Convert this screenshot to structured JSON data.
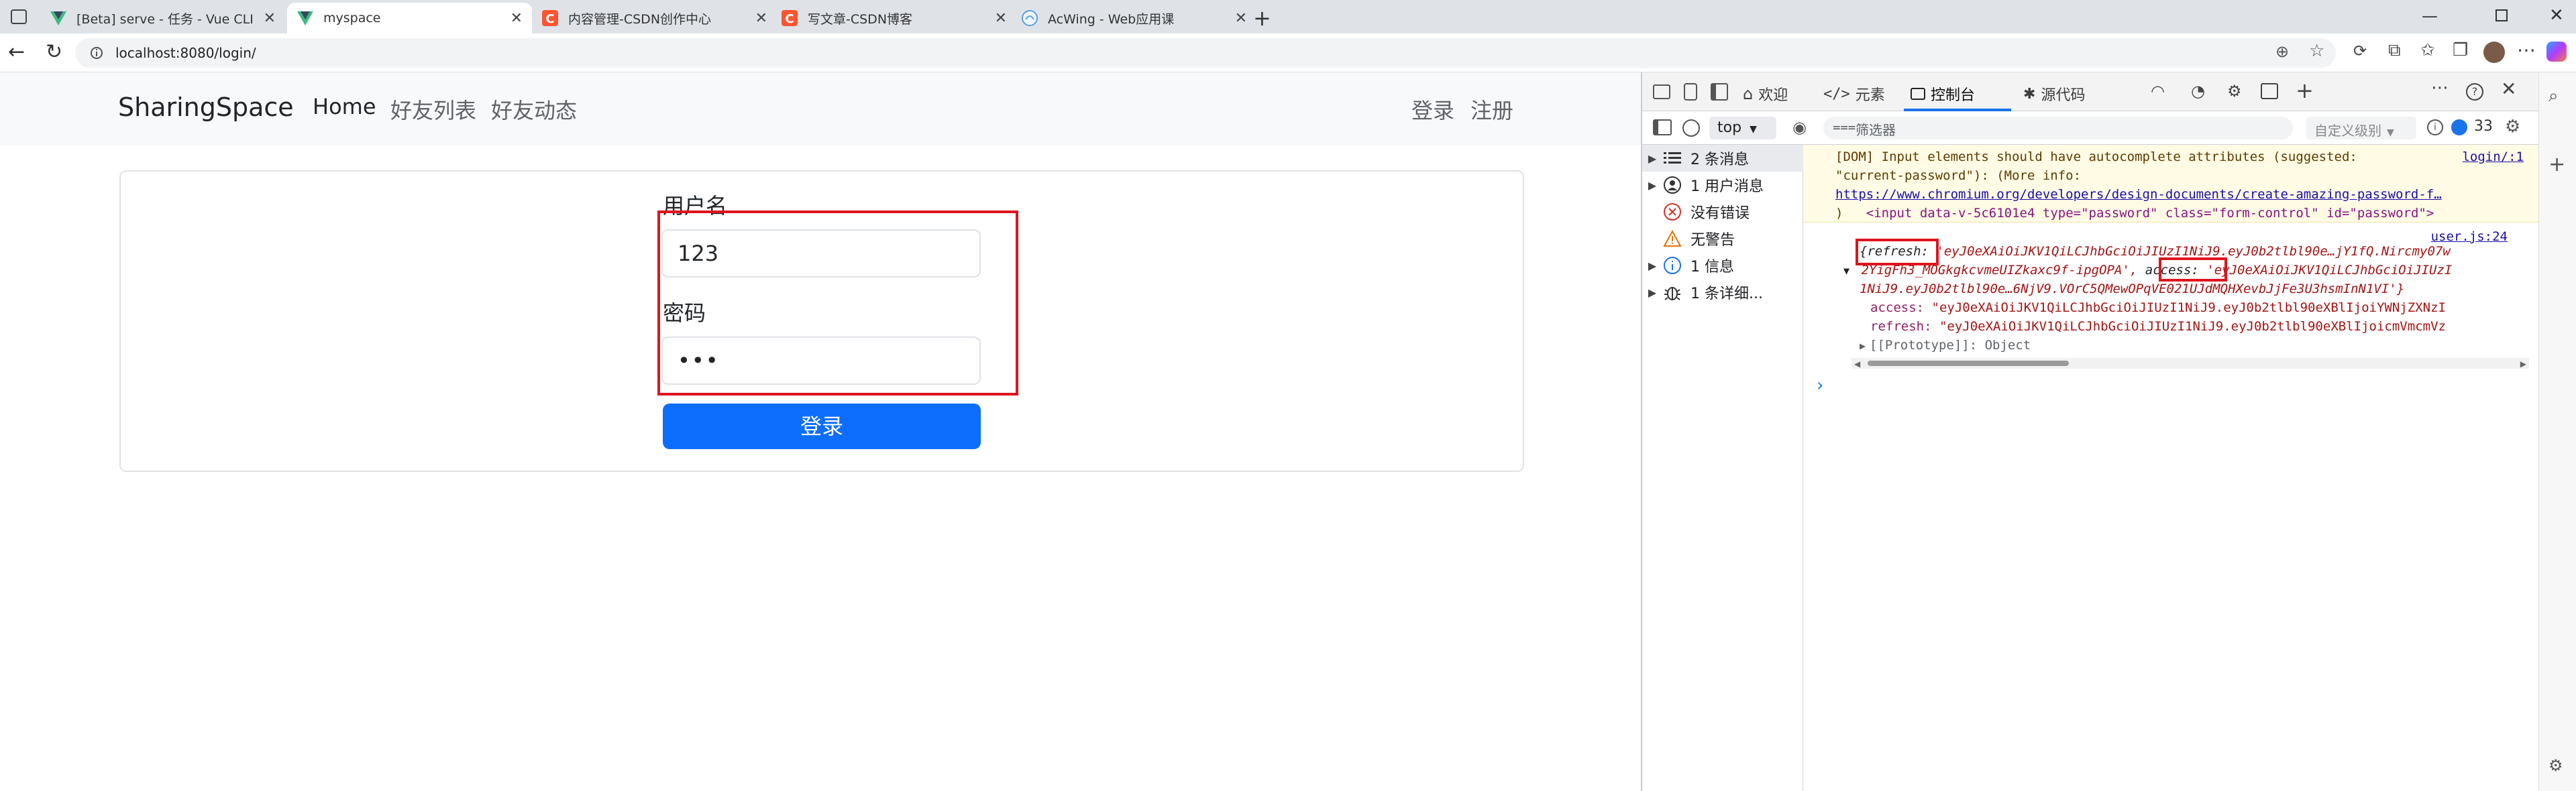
{
  "browser": {
    "tabs": [
      {
        "title": "[Beta] serve - 任务 - Vue CLI",
        "favicon": "vue-icon"
      },
      {
        "title": "myspace",
        "favicon": "vue-icon",
        "active": true
      },
      {
        "title": "内容管理-CSDN创作中心",
        "favicon": "csdn-icon"
      },
      {
        "title": "写文章-CSDN博客",
        "favicon": "csdn-icon"
      },
      {
        "title": "AcWing - Web应用课",
        "favicon": "acwing-icon"
      }
    ],
    "url": "localhost:8080/login/"
  },
  "page": {
    "brand": "SharingSpace",
    "nav": {
      "home": "Home",
      "friends": "好友列表",
      "moments": "好友动态",
      "login": "登录",
      "register": "注册"
    },
    "form": {
      "username_label": "用户名",
      "username_value": "123",
      "password_label": "密码",
      "password_value": "•••",
      "submit_label": "登录"
    }
  },
  "devtools": {
    "tabs": {
      "welcome": "欢迎",
      "elements": "元素",
      "console": "控制台",
      "sources": "源代码"
    },
    "context": "top",
    "filter_placeholder": "筛选器",
    "level": "自定义级别",
    "issue_count": "33",
    "sidebar": [
      {
        "label": "2 条消息"
      },
      {
        "label": "1 用户消息"
      },
      {
        "label": "没有错误"
      },
      {
        "label": "无警告"
      },
      {
        "label": "1 信息"
      },
      {
        "label": "1 条详细..."
      }
    ],
    "console": {
      "warning_line1": "[DOM] Input elements should have autocomplete attributes (suggested:",
      "warning_source": "login/:1",
      "warning_line2": "\"current-password\"): (More info:",
      "warning_link": "https://www.chromium.org/developers/design-documents/create-amazing-password-f…",
      "warning_line3_close": ")",
      "warning_element": "<input data-v-5c6101e4 type=\"password\" class=\"form-control\" id=\"password\">",
      "log_source": "user.js:24",
      "log_refresh_key": "{refresh:",
      "log_refresh_val": "'eyJ0eXAiOiJKV1QiLCJhbGciOiJIUzI1NiJ9.eyJ0b2tlbl90e…jY1fQ.Nircmy07w",
      "log_line2_prefix": "2YigFh3_MOGkgkcvmeUIZkaxc9f-ipgOPA',",
      "log_access_key": "access:",
      "log_access_val": "'eyJ0eXAiOiJKV1QiLCJhbGciOiJIUzI",
      "log_line3": "1NiJ9.eyJ0b2tlbl90e…6NjV9.VOrC5QMewOPqVE021UJdMQHXevbJjFe3U3hsmInN1VI'}",
      "prop_access_key": "access:",
      "prop_access_val": "\"eyJ0eXAiOiJKV1QiLCJhbGciOiJIUzI1NiJ9.eyJ0b2tlbl90eXBlIjoiYWNjZXNzI",
      "prop_refresh_key": "refresh:",
      "prop_refresh_val": "\"eyJ0eXAiOiJKV1QiLCJhbGciOiJIUzI1NiJ9.eyJ0b2tlbl90eXBlIjoicmVmcmVz",
      "prototype": "[[Prototype]]: Object",
      "prompt": "›"
    }
  }
}
